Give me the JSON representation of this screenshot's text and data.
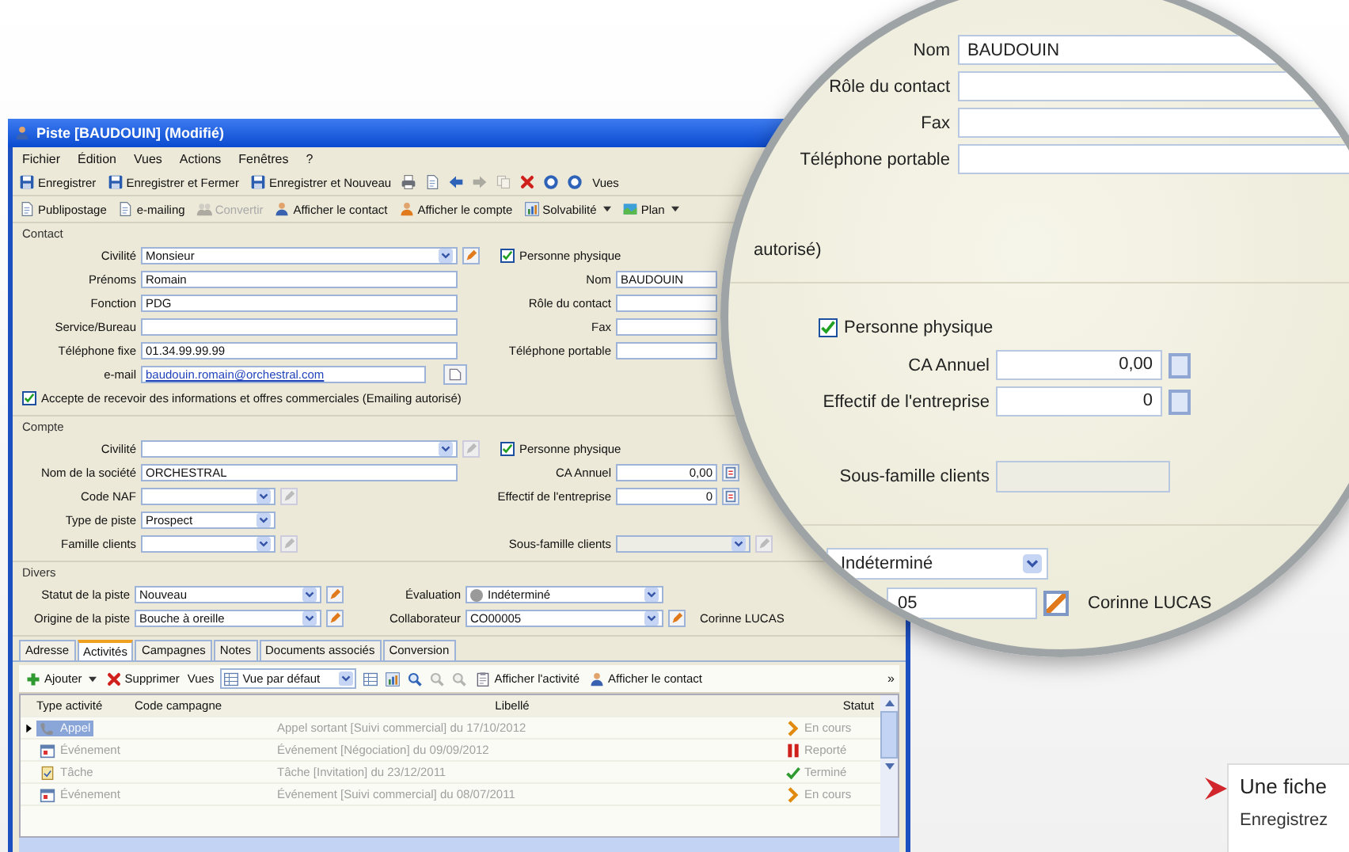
{
  "window": {
    "title": "Piste [BAUDOUIN] (Modifié)"
  },
  "menu": [
    "Fichier",
    "Édition",
    "Vues",
    "Actions",
    "Fenêtres",
    "?"
  ],
  "toolbar": [
    {
      "label": "Enregistrer",
      "disabled": false
    },
    {
      "label": "Enregistrer et Fermer",
      "disabled": false
    },
    {
      "label": "Enregistrer et Nouveau",
      "disabled": false
    },
    {
      "disabled": false
    },
    {
      "disabled": false
    },
    {
      "disabled": false
    },
    {
      "disabled": true
    },
    {
      "disabled": true
    },
    {
      "disabled": false
    },
    {
      "disabled": false
    },
    {
      "disabled": false
    },
    {
      "label": "Vues",
      "disabled": false
    }
  ],
  "toolbar2": [
    {
      "kind": "button",
      "label": "Publipostage",
      "disabled": false
    },
    {
      "kind": "button",
      "label": "e-mailing",
      "disabled": false
    },
    {
      "kind": "button",
      "label": "Convertir",
      "disabled": true
    },
    {
      "kind": "button",
      "label": "Afficher le contact",
      "disabled": false
    },
    {
      "kind": "button",
      "label": "Afficher le compte",
      "disabled": false
    },
    {
      "kind": "menu",
      "label": "Solvabilité",
      "disabled": false
    },
    {
      "kind": "menu",
      "label": "Plan",
      "disabled": false
    }
  ],
  "sections": [
    {
      "title": "Contact",
      "kind": "wide",
      "rows": [
        {
          "left": {
            "kind": "combo",
            "label": "Civilité",
            "value": "Monsieur",
            "edit_disabled": false
          },
          "right": {
            "kind": "checkbox",
            "label": "Personne physique",
            "checked": true
          }
        },
        {
          "left": {
            "kind": "text",
            "label": "Prénoms",
            "value": "Romain"
          },
          "right": {
            "kind": "text",
            "label": "Nom",
            "value": "BAUDOUIN"
          }
        },
        {
          "left": {
            "kind": "text",
            "label": "Fonction",
            "value": "PDG"
          },
          "right": {
            "kind": "text",
            "label": "Rôle du contact"
          }
        },
        {
          "left": {
            "kind": "text",
            "label": "Service/Bureau"
          },
          "right": {
            "kind": "text",
            "label": "Fax"
          }
        },
        {
          "left": {
            "kind": "text",
            "label": "Téléphone fixe",
            "value": "01.34.99.99.99"
          },
          "right": {
            "kind": "text",
            "label": "Téléphone portable"
          }
        },
        {
          "left": {
            "kind": "email",
            "label": "e-mail",
            "value": "baudouin.romain@orchestral.com"
          }
        },
        {
          "full": {
            "kind": "checkbox",
            "label": "Accepte de recevoir des informations et offres commerciales (Emailing autorisé)",
            "checked": true
          }
        }
      ]
    },
    {
      "title": "Compte",
      "kind": "wide",
      "rows": [
        {
          "left": {
            "kind": "combo",
            "label": "Civilité",
            "edit_disabled": true
          },
          "right": {
            "kind": "checkbox",
            "label": "Personne physique",
            "checked": true
          }
        },
        {
          "left": {
            "kind": "text",
            "label": "Nom de la société",
            "value": "ORCHESTRAL"
          },
          "right": {
            "kind": "number",
            "label": "CA Annuel",
            "value": "0,00"
          }
        },
        {
          "left": {
            "kind": "combo_short",
            "label": "Code NAF",
            "edit_disabled": true
          },
          "right": {
            "kind": "number",
            "label": "Effectif de l'entreprise",
            "value": "0"
          }
        },
        {
          "left": {
            "kind": "combo_short",
            "label": "Type de piste",
            "value": "Prospect"
          }
        },
        {
          "left": {
            "kind": "combo_short",
            "label": "Famille clients",
            "edit_disabled": true
          },
          "right": {
            "kind": "combo_disabled",
            "label": "Sous-famille clients",
            "edit_disabled": true
          }
        }
      ]
    },
    {
      "title": "Divers",
      "kind": "compact",
      "rows": [
        {
          "left": {
            "kind": "combo",
            "label": "Statut de la piste",
            "value": "Nouveau",
            "edit_disabled": false
          },
          "right": {
            "kind": "picker",
            "label": "Évaluation",
            "value": "Indéterminé"
          }
        },
        {
          "left": {
            "kind": "combo",
            "label": "Origine de la piste",
            "value": "Bouche à oreille",
            "edit_disabled": false
          },
          "right": {
            "kind": "combo",
            "label": "Collaborateur",
            "value": "CO00005",
            "edit_disabled": false,
            "note": "Corinne LUCAS"
          }
        }
      ]
    }
  ],
  "tabs": [
    {
      "label": "Adresse",
      "selected": false
    },
    {
      "label": "Activités",
      "selected": true
    },
    {
      "label": "Campagnes",
      "selected": false
    },
    {
      "label": "Notes",
      "selected": false
    },
    {
      "label": "Documents associés",
      "selected": false
    },
    {
      "label": "Conversion",
      "selected": false
    }
  ],
  "activity_toolbar": [
    {
      "kind": "menu",
      "label": "Ajouter",
      "disabled": false
    },
    {
      "kind": "button",
      "label": "Supprimer",
      "disabled": false
    },
    {
      "kind": "text",
      "label": "Vues"
    },
    {
      "kind": "view",
      "label": "Vue par défaut"
    },
    {
      "kind": "icon",
      "disabled": false
    },
    {
      "kind": "icon",
      "disabled": false
    },
    {
      "kind": "icon",
      "disabled": false
    },
    {
      "kind": "icon",
      "disabled": true
    },
    {
      "kind": "icon",
      "disabled": true
    },
    {
      "kind": "button",
      "label": "Afficher l'activité",
      "disabled": false
    },
    {
      "kind": "button",
      "label": "Afficher le contact",
      "disabled": false
    }
  ],
  "overflow": "»",
  "grid": {
    "columns": [
      "Type activité",
      "Code campagne",
      "Libellé",
      "Statut"
    ],
    "rows": [
      {
        "kind": "call",
        "type": "Appel",
        "label": "Appel sortant [Suivi commercial]  du 17/10/2012",
        "status": {
          "kind": "in_progress",
          "text": "En cours"
        },
        "selected": true
      },
      {
        "kind": "event",
        "type": "Événement",
        "label": "Événement [Négociation]  du 09/09/2012",
        "status": {
          "kind": "postponed",
          "text": "Reporté"
        },
        "selected": false
      },
      {
        "kind": "task",
        "type": "Tâche",
        "label": "Tâche [Invitation]  du 23/12/2011",
        "status": {
          "kind": "done",
          "text": "Terminé"
        },
        "selected": false
      },
      {
        "kind": "event",
        "type": "Événement",
        "label": "Événement [Suivi commercial]  du 08/07/2011",
        "status": {
          "kind": "in_progress",
          "text": "En cours"
        },
        "selected": false
      }
    ]
  },
  "magnifier": {
    "rows": [
      {
        "label": "Nom",
        "value": "BAUDOUIN"
      },
      {
        "label": "Rôle du contact"
      },
      {
        "label": "Fax"
      },
      {
        "label": "Téléphone portable"
      }
    ],
    "fragment": "autorisé)",
    "checkbox": {
      "label": "Personne physique",
      "checked": true
    },
    "numbers": [
      {
        "label": "CA Annuel",
        "value": "0,00"
      },
      {
        "label": "Effectif de l'entreprise",
        "value": "0"
      }
    ],
    "subfamily": "Sous-famille clients",
    "evaluation": "Indéterminé",
    "collaborator": "05",
    "collaborator_name": "Corinne LUCAS"
  },
  "callout": {
    "title": "Une fiche",
    "text": "Enregistrez"
  }
}
